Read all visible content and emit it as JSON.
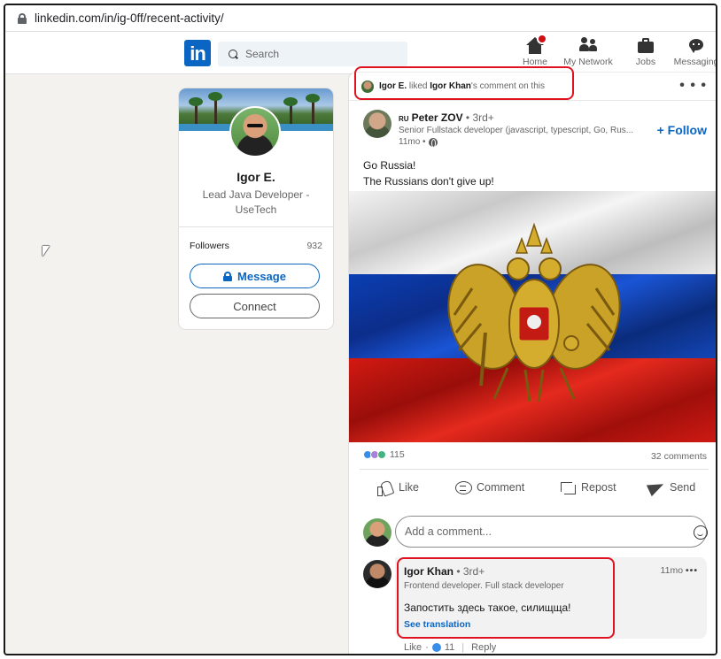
{
  "browser": {
    "url": "linkedin.com/in/ig-0ff/recent-activity/"
  },
  "nav": {
    "logo": "in",
    "search_placeholder": "Search",
    "items": [
      {
        "label": "Home",
        "icon": "home-icon"
      },
      {
        "label": "My Network",
        "icon": "network-icon"
      },
      {
        "label": "Jobs",
        "icon": "briefcase-icon"
      },
      {
        "label": "Messaging",
        "icon": "messaging-icon"
      }
    ],
    "home_badge_color": "#cc1016"
  },
  "profile": {
    "name": "Igor E.",
    "headline": "Lead Java Developer - UseTech",
    "followers_label": "Followers",
    "followers_count": "932",
    "message_button": "Message",
    "connect_button": "Connect"
  },
  "post": {
    "activity": {
      "actor": "Igor E.",
      "verb": " liked ",
      "target": "Igor Khan",
      "suffix": "'s comment on this"
    },
    "more": "• • •",
    "author": {
      "flag": "RU",
      "name": "Peter ZOV",
      "degree": " • 3rd+",
      "headline": "Senior Fullstack developer (javascript, typescript, Go, Rus...",
      "time": "11mo •"
    },
    "follow_button": "+ Follow",
    "text_line1": "Go Russia!",
    "text_line2": "The Russians don't give up!",
    "image": {
      "colors": [
        "#ffffff",
        "#0c3eb0",
        "#d01c14"
      ]
    },
    "reactions_count": "115",
    "comments_count": "32 comments",
    "actions": {
      "like": "Like",
      "comment": "Comment",
      "repost": "Repost",
      "send": "Send"
    },
    "add_comment_placeholder": "Add a comment..."
  },
  "comment": {
    "name": "Igor Khan",
    "degree": " • 3rd+",
    "headline": "Frontend developer. Full stack developer",
    "time": "11mo",
    "more": "•••",
    "text": "Запостить здесь такое, силищща!",
    "translate": "See translation",
    "like_label": "Like",
    "likes": "11",
    "reply_label": "Reply"
  },
  "accent": "#0a66c2",
  "annotation_color": "#e0121f"
}
